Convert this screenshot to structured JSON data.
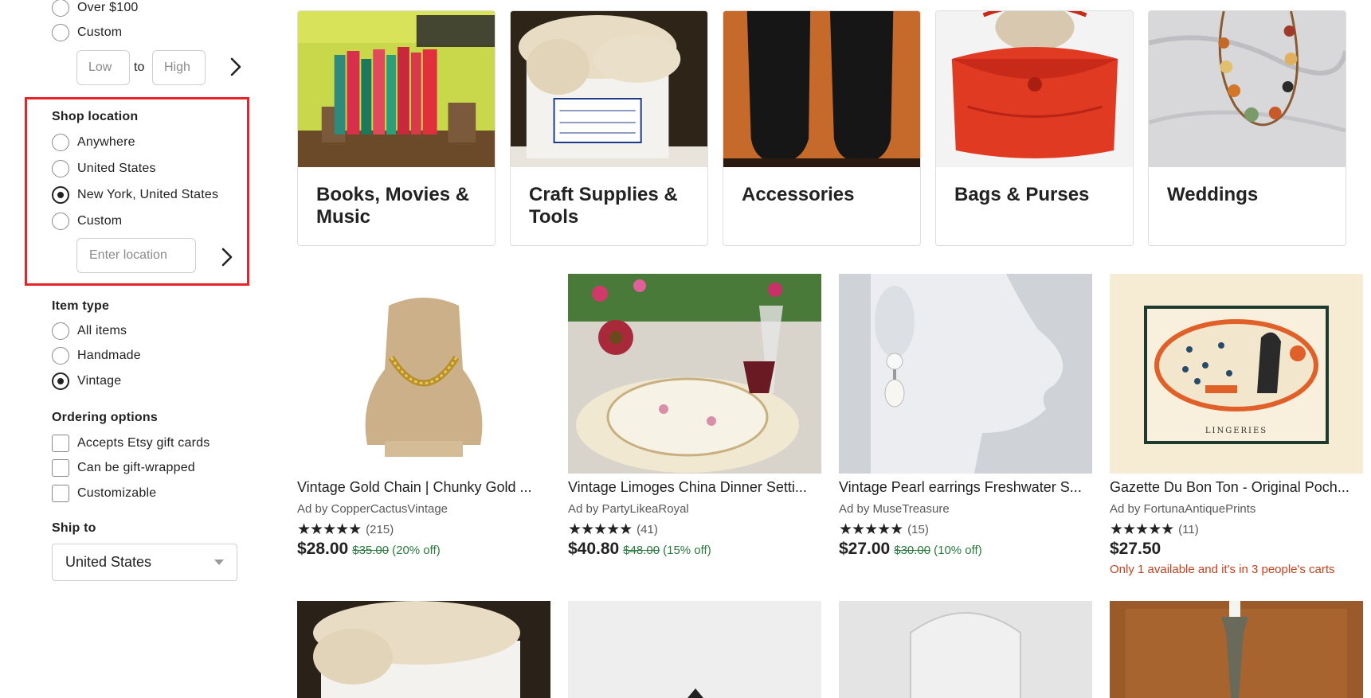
{
  "price_filter": {
    "options": [
      {
        "label": "Over $100",
        "selected": false
      },
      {
        "label": "Custom",
        "selected": false
      }
    ],
    "low_placeholder": "Low",
    "to_label": "to",
    "high_placeholder": "High"
  },
  "shop_location": {
    "title": "Shop location",
    "options": [
      {
        "label": "Anywhere",
        "selected": false
      },
      {
        "label": "United States",
        "selected": false
      },
      {
        "label": "New York, United States",
        "selected": true
      },
      {
        "label": "Custom",
        "selected": false
      }
    ],
    "location_placeholder": "Enter location"
  },
  "item_type": {
    "title": "Item type",
    "options": [
      {
        "label": "All items",
        "selected": false
      },
      {
        "label": "Handmade",
        "selected": false
      },
      {
        "label": "Vintage",
        "selected": true
      }
    ]
  },
  "ordering_options": {
    "title": "Ordering options",
    "options": [
      {
        "label": "Accepts Etsy gift cards",
        "checked": false
      },
      {
        "label": "Can be gift-wrapped",
        "checked": false
      },
      {
        "label": "Customizable",
        "checked": false
      }
    ]
  },
  "ship_to": {
    "title": "Ship to",
    "selected": "United States"
  },
  "categories": [
    {
      "title": "Books, Movies & Music"
    },
    {
      "title": "Craft Supplies & Tools"
    },
    {
      "title": "Accessories"
    },
    {
      "title": "Bags & Purses"
    },
    {
      "title": "Weddings"
    }
  ],
  "listings": [
    {
      "title": "Vintage Gold Chain | Chunky Gold ...",
      "shop": "Ad by CopperCactusVintage",
      "stars": "★★★★★",
      "reviews": "(215)",
      "price": "$28.00",
      "original_price": "$35.00",
      "discount": "(20% off)",
      "note": ""
    },
    {
      "title": "Vintage Limoges China Dinner Setti...",
      "shop": "Ad by PartyLikeaRoyal",
      "stars": "★★★★★",
      "reviews": "(41)",
      "price": "$40.80",
      "original_price": "$48.00",
      "discount": "(15% off)",
      "note": ""
    },
    {
      "title": "Vintage Pearl earrings Freshwater S...",
      "shop": "Ad by MuseTreasure",
      "stars": "★★★★★",
      "reviews": "(15)",
      "price": "$27.00",
      "original_price": "$30.00",
      "discount": "(10% off)",
      "note": ""
    },
    {
      "title": "Gazette Du Bon Ton - Original Poch...",
      "shop": "Ad by FortunaAntiquePrints",
      "stars": "★★★★★",
      "reviews": "(11)",
      "price": "$27.50",
      "original_price": "",
      "discount": "",
      "note": "Only 1 available and it's in 3 people's carts"
    }
  ],
  "print_caption": "LINGERIES",
  "colors": {
    "highlight": "#e8242a",
    "sale_green": "#2b7a3f",
    "scarcity_red": "#c4411d"
  }
}
